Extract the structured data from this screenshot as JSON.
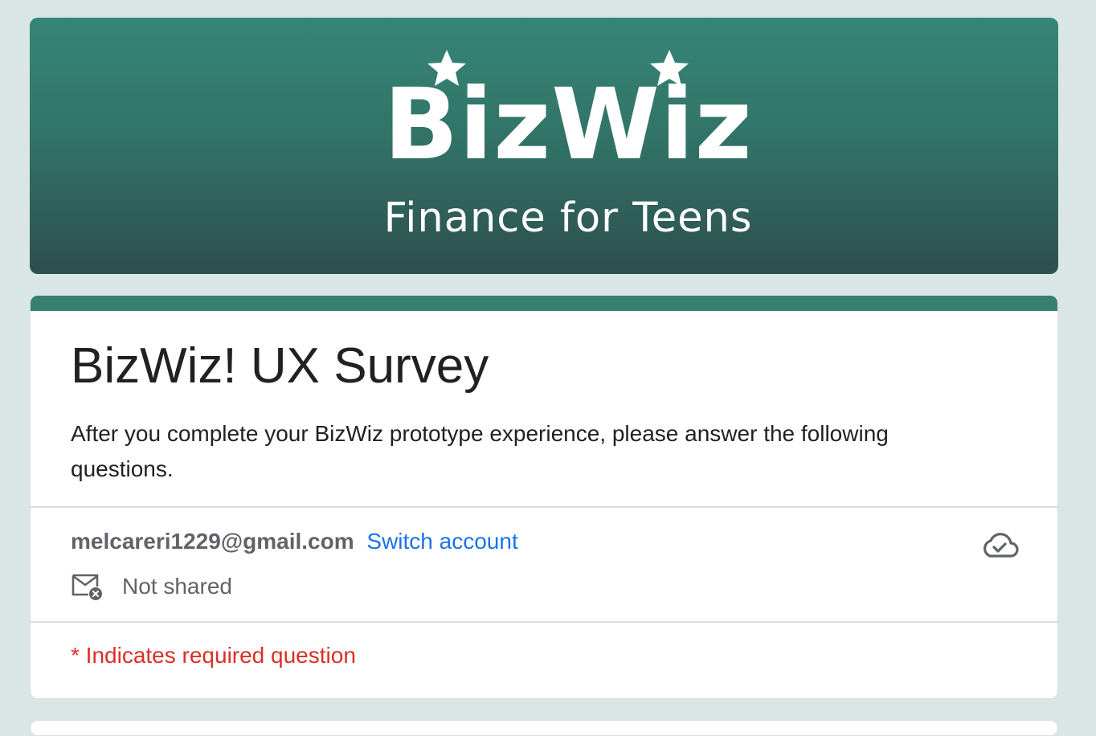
{
  "banner": {
    "logo_icon": "bizwiz-logo",
    "logo_title": "BizWiz",
    "subtitle": "Finance for Teens",
    "colors": {
      "top": "#358677",
      "bottom": "#2d4f4d"
    }
  },
  "form": {
    "title": "BizWiz! UX Survey",
    "description": "After you complete your BizWiz prototype experience, please answer the following questions.",
    "accent_color": "#37806f",
    "account": {
      "email": "melcareri1229@gmail.com",
      "switch_label": "Switch account",
      "cloud_icon": "cloud-check-icon",
      "mail_icon": "mail-not-shared-icon",
      "shared_status": "Not shared"
    },
    "required_note": "* Indicates required question"
  },
  "colors": {
    "page_bg": "#d9e6e5",
    "link": "#1a73e8",
    "required": "#d93025"
  }
}
